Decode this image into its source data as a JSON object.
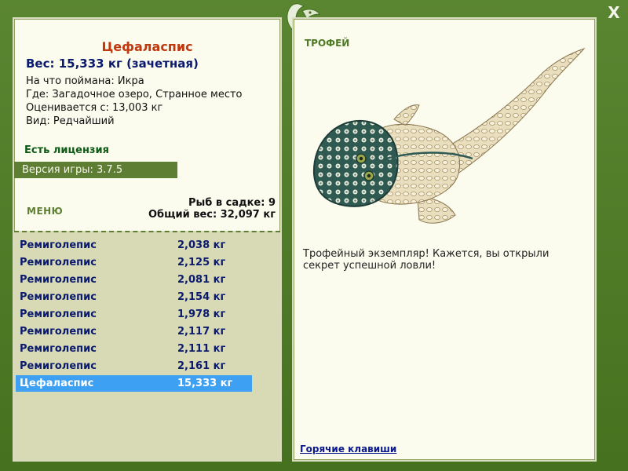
{
  "window": {
    "close_label": "X",
    "logo_icon": "fish-leaf-icon"
  },
  "fish": {
    "name": "Цефаласпис",
    "weight_line": "Вес: 15,333 кг (зачетная)",
    "bait_line": "На что поймана: Икра",
    "place_line": "Где: Загадочное озеро, Странное место",
    "value_line": "Оценивается с: 13,003 кг",
    "type_line": "Вид: Редчайший"
  },
  "license_text": "Есть лицензия",
  "version_text": "Версия игры: 3.7.5",
  "menu_label": "МЕНЮ",
  "keepnet": {
    "count_text": "Рыб в садке: 9",
    "total_text": "Общий вес: 32,097 кг"
  },
  "catch_list": [
    {
      "name": "Ремиголепис",
      "weight": "2,038 кг"
    },
    {
      "name": "Ремиголепис",
      "weight": "2,125 кг"
    },
    {
      "name": "Ремиголепис",
      "weight": "2,081 кг"
    },
    {
      "name": "Ремиголепис",
      "weight": "2,154 кг"
    },
    {
      "name": "Ремиголепис",
      "weight": "1,978 кг"
    },
    {
      "name": "Ремиголепис",
      "weight": "2,117 кг"
    },
    {
      "name": "Ремиголепис",
      "weight": "2,111 кг"
    },
    {
      "name": "Ремиголепис",
      "weight": "2,161 кг"
    },
    {
      "name": "Цефаласпис",
      "weight": "15,333 кг",
      "selected": true
    }
  ],
  "trophy": {
    "label": "ТРОФЕЙ",
    "text": "Трофейный экземпляр! Кажется, вы открыли секрет успешной ловли!",
    "image_icon": "cephalaspis-fish-illustration"
  },
  "hotkeys_label": "Горячие клавиши",
  "colors": {
    "frame_green": "#4f7a2a",
    "panel_bg": "#fbfbee",
    "list_bg": "#d8dab6",
    "selected_row": "#3ea0f2",
    "title_red": "#c0380e",
    "text_navy": "#0a1a6e"
  }
}
